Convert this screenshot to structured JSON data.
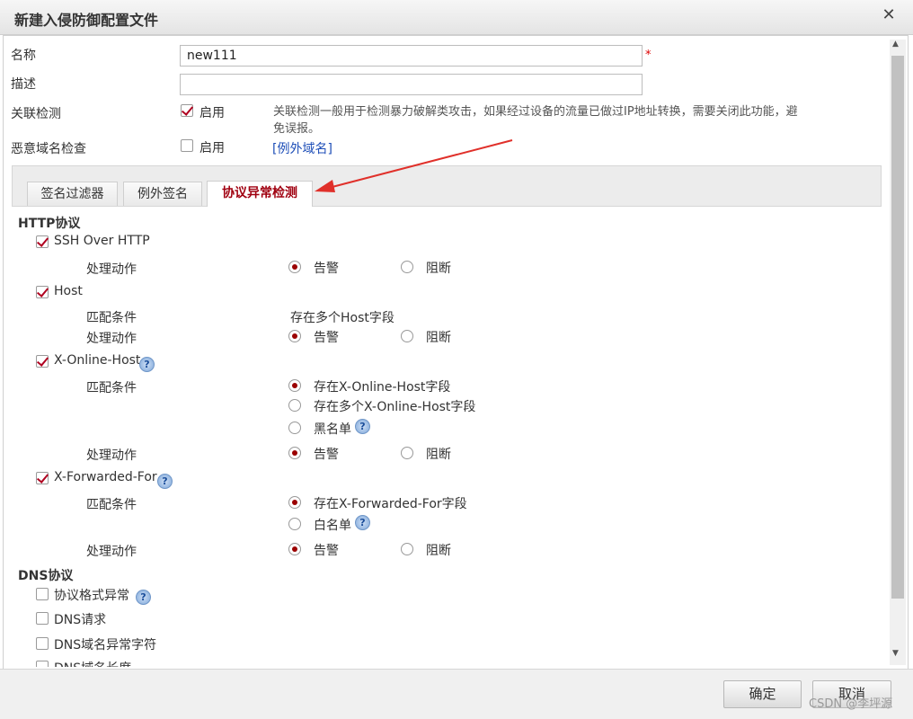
{
  "dialog": {
    "title": "新建入侵防御配置文件"
  },
  "form": {
    "name_label": "名称",
    "name_value": "new111",
    "required_mark": "*",
    "desc_label": "描述",
    "desc_value": "",
    "assoc_label": "关联检测",
    "assoc_enable": "启用",
    "assoc_checked": true,
    "assoc_desc_line1": "关联检测一般用于检测暴力破解类攻击，如果经过设备的流量已做过IP地址转换，需要关闭此功能，避",
    "assoc_desc_line2": "免误报。",
    "malicious_label": "恶意域名检查",
    "malicious_enable": "启用",
    "malicious_checked": false,
    "exception_domain_link": "[例外域名]"
  },
  "tabs": [
    {
      "label": "签名过滤器",
      "active": false
    },
    {
      "label": "例外签名",
      "active": false
    },
    {
      "label": "协议异常检测",
      "active": true
    }
  ],
  "http": {
    "title": "HTTP协议",
    "ssh": {
      "label": "SSH Over HTTP",
      "checked": true,
      "action_label": "处理动作",
      "alert": "告警",
      "block": "阻断",
      "selected": "alert"
    },
    "host": {
      "label": "Host",
      "checked": true,
      "match_label": "匹配条件",
      "match_value": "存在多个Host字段",
      "action_label": "处理动作",
      "alert": "告警",
      "block": "阻断",
      "selected": "alert"
    },
    "xonline": {
      "label": "X-Online-Host",
      "checked": true,
      "match_label": "匹配条件",
      "options": [
        "存在X-Online-Host字段",
        "存在多个X-Online-Host字段",
        "黑名单"
      ],
      "selected_option": 0,
      "action_label": "处理动作",
      "alert": "告警",
      "block": "阻断",
      "selected": "alert"
    },
    "xforwarded": {
      "label": "X-Forwarded-For",
      "checked": true,
      "match_label": "匹配条件",
      "options": [
        "存在X-Forwarded-For字段",
        "白名单"
      ],
      "selected_option": 0,
      "action_label": "处理动作",
      "alert": "告警",
      "block": "阻断",
      "selected": "alert"
    }
  },
  "dns": {
    "title": "DNS协议",
    "items": [
      {
        "label": "协议格式异常",
        "checked": false
      },
      {
        "label": "DNS请求",
        "checked": false
      },
      {
        "label": "DNS域名异常字符",
        "checked": false
      },
      {
        "label": "DNS域名长度",
        "checked": false
      }
    ]
  },
  "footer": {
    "ok": "确定",
    "cancel": "取消"
  },
  "watermark": "CSDN @李坪源",
  "colors": {
    "accent": "#a00010",
    "link": "#1f4fb8",
    "annotation_arrow": "#e0302a"
  }
}
